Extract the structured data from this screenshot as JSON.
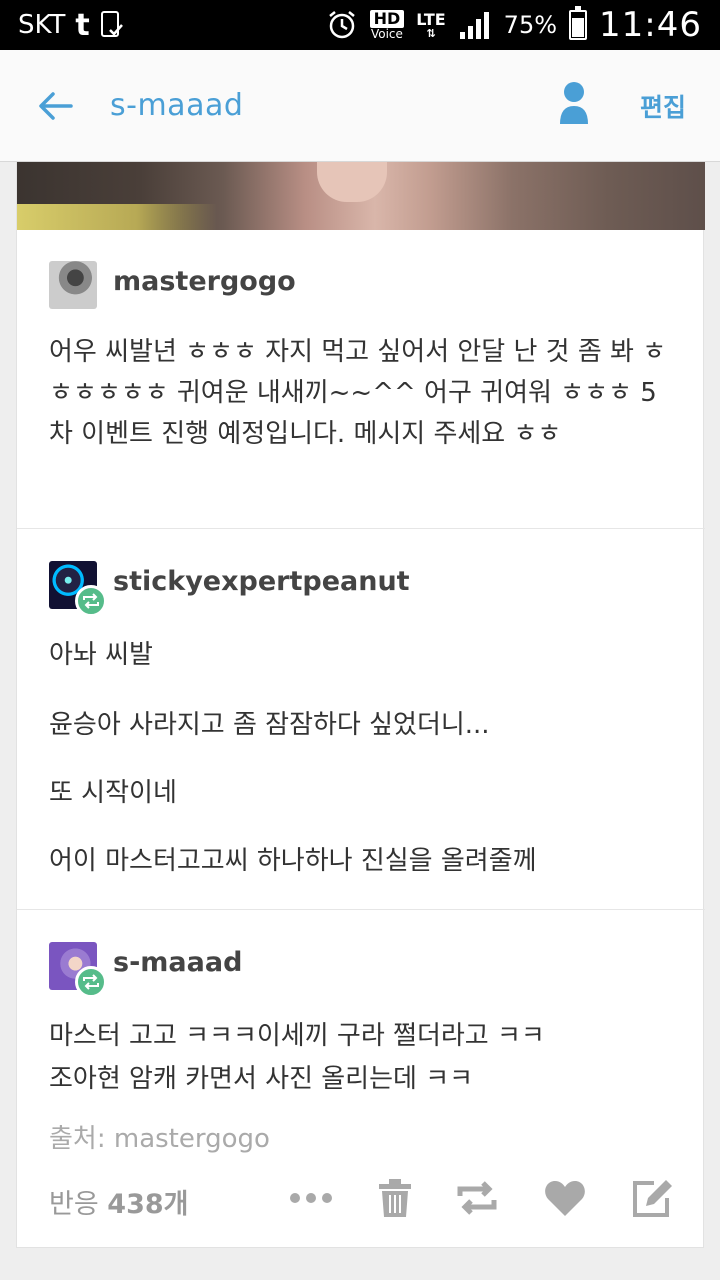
{
  "status_bar": {
    "carrier": "SKT",
    "carrier_app": "t",
    "hd_label": "HD",
    "voice_label": "Voice",
    "network": "LTE",
    "battery": "75%",
    "battery_level": 0.75,
    "time": "11:46"
  },
  "app_bar": {
    "title": "s-maaad",
    "edit_label": "편집"
  },
  "post": {
    "entries": [
      {
        "username": "mastergogo",
        "text": "어우 씨발년 ㅎㅎㅎ 자지 먹고 싶어서 안달 난 것 좀 봐 ㅎㅎㅎㅎㅎㅎ 귀여운 내새끼~~^^ 어구 귀여워 ㅎㅎㅎ 5차 이벤트 진행 예정입니다. 메시지 주세요 ㅎㅎ"
      },
      {
        "username": "stickyexpertpeanut",
        "paragraphs": [
          "아놔 씨발",
          "윤승아 사라지고 좀 잠잠하다 싶었더니...",
          "또 시작이네",
          "어이 마스터고고씨 하나하나 진실을 올려줄께"
        ]
      },
      {
        "username": "s-maaad",
        "paragraphs": [
          "마스터 고고 ㅋㅋㅋ이세끼 구라 쩔더라고 ㅋㅋ",
          "조아현 암캐 카면서 사진 올리는데 ㅋㅋ"
        ]
      }
    ],
    "source_label": "출처:",
    "source_name": "mastergogo",
    "notes_label": "반응",
    "notes_count": "438개"
  }
}
